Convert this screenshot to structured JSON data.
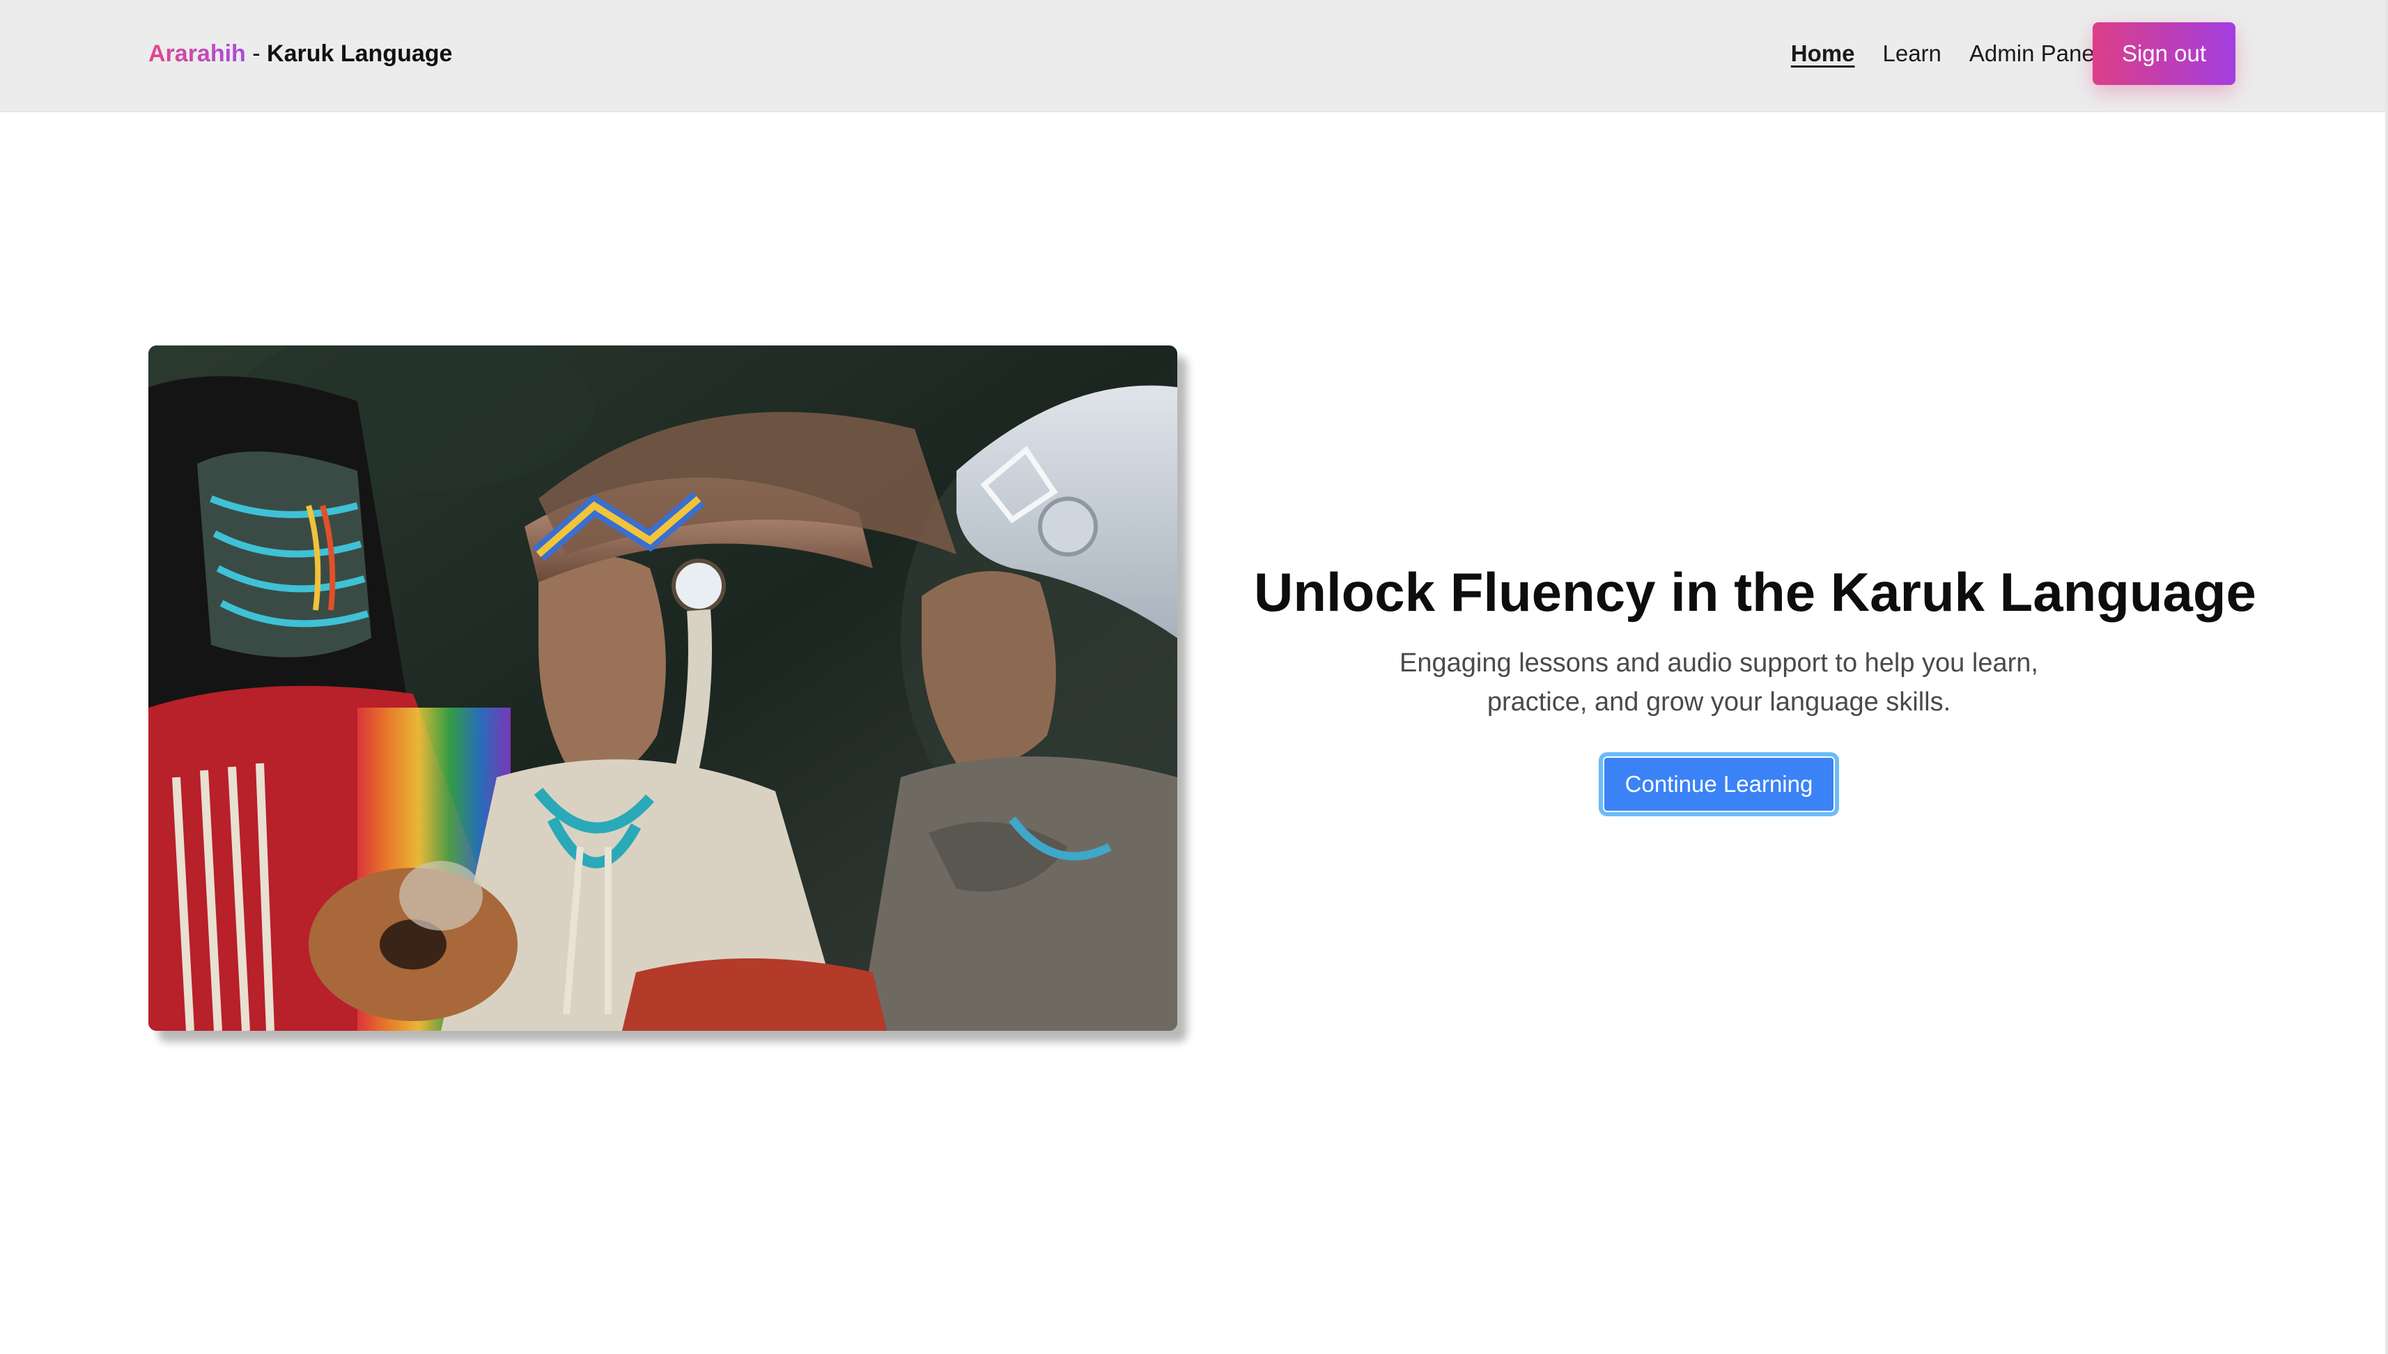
{
  "brand": {
    "accent": "Ararahih",
    "separator": " - ",
    "title": "Karuk Language"
  },
  "nav": {
    "links": [
      {
        "label": "Home",
        "active": true
      },
      {
        "label": "Learn",
        "active": false
      },
      {
        "label": "Admin Panel",
        "active": false
      }
    ],
    "theme_toggle_icon": "moon-icon",
    "sign_out_label": "Sign out"
  },
  "hero": {
    "title": "Unlock Fluency in the Karuk Language",
    "subtitle": "Engaging lessons and audio support to help you learn, practice, and grow your language skills.",
    "cta_label": "Continue Learning"
  },
  "colors": {
    "navbar_bg": "#ececec",
    "brand_gradient_start": "#e0488a",
    "brand_gradient_end": "#a84be0",
    "cta_bg": "#3b82f6",
    "cta_ring": "#6bbcf7"
  }
}
